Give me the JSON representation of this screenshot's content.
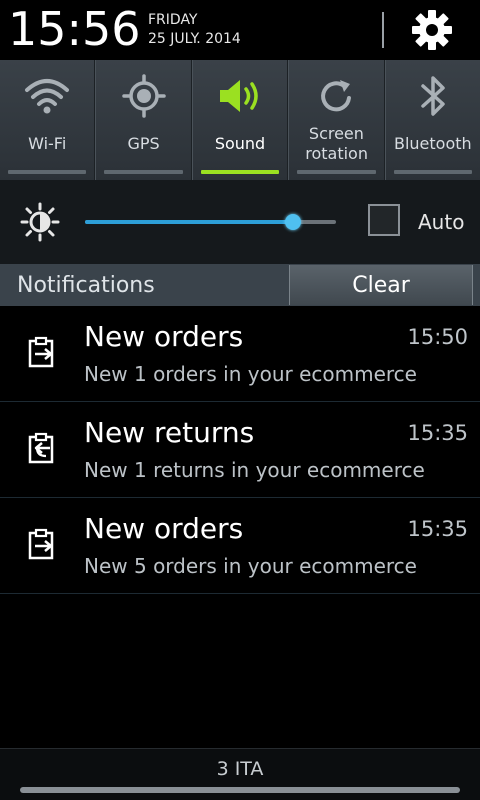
{
  "status": {
    "time": "15:56",
    "day": "FRIDAY",
    "date": "25 JULY. 2014"
  },
  "quick_settings": [
    {
      "label": "Wi-Fi",
      "icon": "wifi-icon",
      "enabled": false
    },
    {
      "label": "GPS",
      "icon": "gps-icon",
      "enabled": false
    },
    {
      "label": "Sound",
      "icon": "sound-icon",
      "enabled": true
    },
    {
      "label": "Screen rotation",
      "icon": "screen-rotation-icon",
      "enabled": false
    },
    {
      "label": "Bluetooth",
      "icon": "bluetooth-icon",
      "enabled": false
    }
  ],
  "brightness": {
    "level": 0.83,
    "auto_label": "Auto",
    "auto_checked": false
  },
  "notifications": {
    "title": "Notifications",
    "clear_label": "Clear",
    "items": [
      {
        "title": "New orders",
        "time": "15:50",
        "body": "New 1 orders in your ecommerce",
        "icon": "order-clipboard-icon"
      },
      {
        "title": "New returns",
        "time": "15:35",
        "body": "New 1 returns in your ecommerce",
        "icon": "return-clipboard-icon"
      },
      {
        "title": "New orders",
        "time": "15:35",
        "body": "New 5 orders in your ecommerce",
        "icon": "order-clipboard-icon"
      }
    ]
  },
  "carrier": {
    "name": "3 ITA"
  },
  "colors": {
    "accent_on": "#9be021",
    "slider_fill": "#2d9fd8",
    "panel_bg": "#3a434b"
  }
}
